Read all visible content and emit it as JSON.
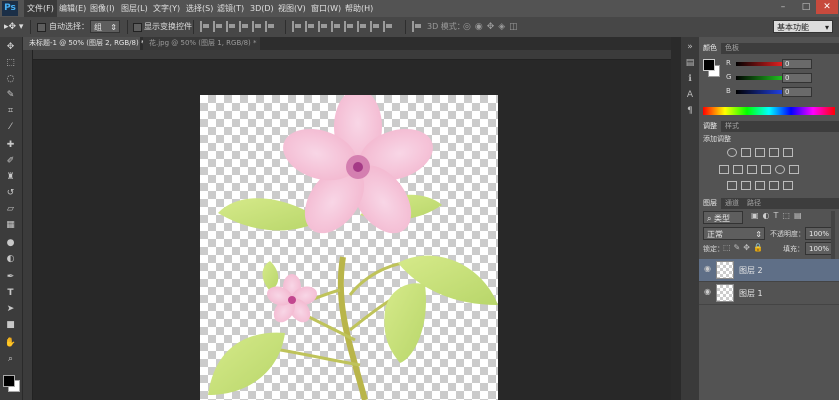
{
  "app": {
    "logo": "Ps"
  },
  "menu": {
    "items": [
      "文件(F)",
      "编辑(E)",
      "图像(I)",
      "图层(L)",
      "文字(Y)",
      "选择(S)",
      "滤镜(T)",
      "3D(D)",
      "视图(V)",
      "窗口(W)",
      "帮助(H)"
    ]
  },
  "window_controls": {
    "minimize": "–",
    "restore": "□",
    "close": "✕"
  },
  "options_bar": {
    "auto_select_label": "自动选择：",
    "auto_select_value": "组",
    "show_transform_label": "显示变换控件",
    "mode_3d_label": "3D 模式：",
    "workspace_value": "基本功能"
  },
  "tools": [
    "move-tool",
    "marquee-tool",
    "lasso-tool",
    "quick-select-tool",
    "crop-tool",
    "eyedropper-tool",
    "healing-brush-tool",
    "brush-tool",
    "clone-stamp-tool",
    "history-brush-tool",
    "eraser-tool",
    "gradient-tool",
    "blur-tool",
    "dodge-tool",
    "pen-tool",
    "type-tool",
    "path-select-tool",
    "shape-tool",
    "hand-tool",
    "zoom-tool"
  ],
  "document_tabs": [
    {
      "label": "未标题-1 @ 50% (图层 2, RGB/8) *",
      "active": true
    },
    {
      "label": "花.jpg @ 50% (图层 1, RGB/8) *",
      "active": false
    }
  ],
  "color_panel": {
    "tabs": [
      "颜色",
      "色板"
    ],
    "channels": [
      {
        "label": "R",
        "value": "0",
        "color": "#e02020"
      },
      {
        "label": "G",
        "value": "0",
        "color": "#20c020"
      },
      {
        "label": "B",
        "value": "0",
        "color": "#2040e0"
      }
    ]
  },
  "adjustments_panel": {
    "tabs": [
      "调整",
      "样式"
    ],
    "heading": "添加调整"
  },
  "layers_panel": {
    "tabs": [
      "图层",
      "通道",
      "路径"
    ],
    "filter_kind": "类型",
    "blend_mode": "正常",
    "opacity_label": "不透明度：",
    "opacity_value": "100%",
    "lock_label": "锁定：",
    "fill_label": "填充：",
    "fill_value": "100%",
    "layers": [
      {
        "name": "图层 2",
        "selected": true
      },
      {
        "name": "图层 1",
        "selected": false
      }
    ]
  },
  "colors": {
    "accent_selected_layer": "#5f6f87"
  }
}
